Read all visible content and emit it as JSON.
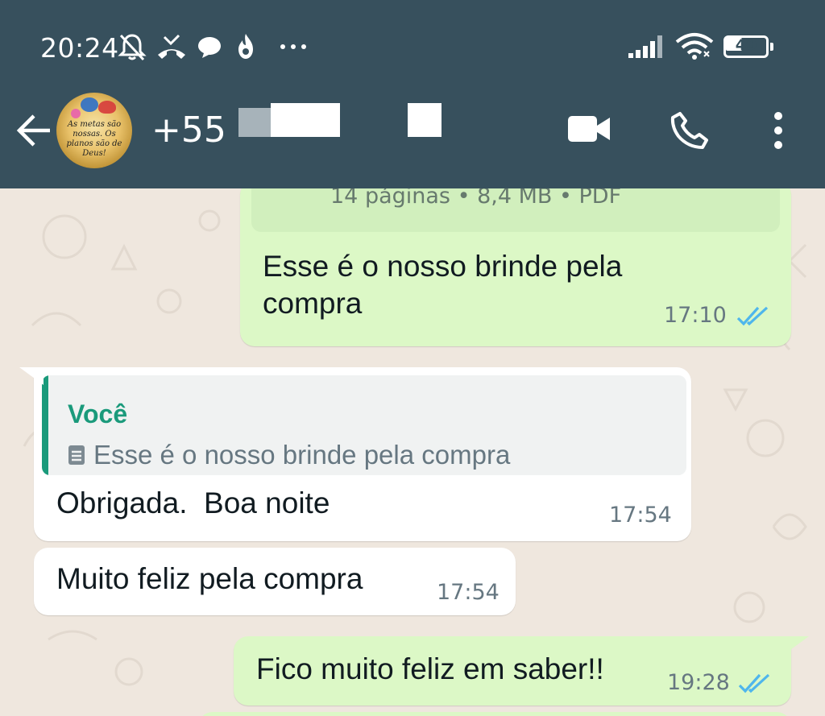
{
  "status_bar": {
    "time": "20:24",
    "battery": "40",
    "battery_level": 0.4,
    "icons": [
      "muted-bell-icon",
      "missed-call-icon",
      "chat-bubble-icon",
      "flame-icon",
      "more-dots-icon",
      "signal-icon",
      "wifi-icon",
      "battery-icon"
    ]
  },
  "chat_header": {
    "contact_name": "+55",
    "avatar_text": "As metas são nossas. Os planos são de Deus!",
    "icons": [
      "back-arrow-icon",
      "video-call-icon",
      "phone-icon",
      "more-vert-icon"
    ]
  },
  "theme": {
    "header_bg": "#37505d",
    "outgoing_bubble": "#dcf8c6",
    "incoming_bubble": "#ffffff",
    "chat_bg": "#efe7de",
    "read_tick": "#4fb6ec",
    "quote_accent": "#1a9a7b"
  },
  "messages": [
    {
      "id": "m1",
      "direction": "outgoing",
      "doc_meta": "14 páginas • 8,4 MB • PDF",
      "text_line1": "Esse é o nosso brinde pela",
      "text_line2": "compra",
      "time": "17:10",
      "status": "read"
    },
    {
      "id": "m2",
      "direction": "incoming",
      "quote_author": "Você",
      "quote_text": "Esse é o nosso brinde pela compra",
      "text": "Obrigada.  Boa noite",
      "time": "17:54"
    },
    {
      "id": "m3",
      "direction": "incoming",
      "text": "Muito feliz pela compra",
      "time": "17:54"
    },
    {
      "id": "m4",
      "direction": "outgoing",
      "text": "Fico muito feliz em saber!!",
      "time": "19:28",
      "status": "read"
    }
  ]
}
